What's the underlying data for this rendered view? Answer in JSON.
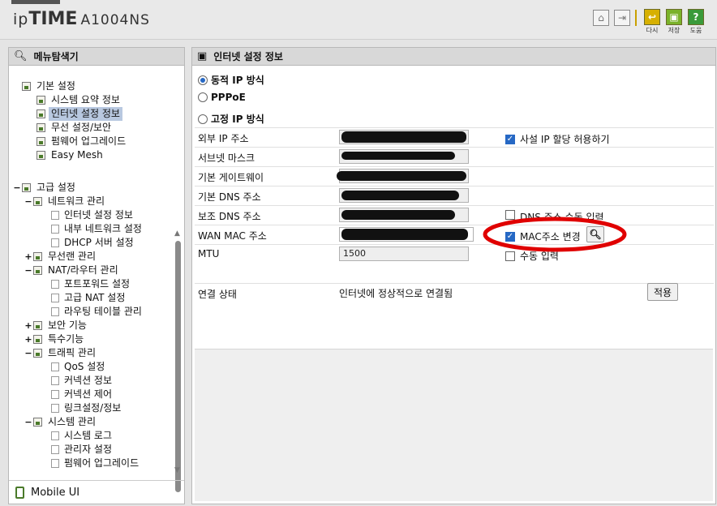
{
  "header": {
    "brand_ip": "ip",
    "brand_time": "TIME",
    "model": "A1004NS",
    "buttons": [
      {
        "label": "다시",
        "icon": "back-icon"
      },
      {
        "label": "저장",
        "icon": "save-icon"
      },
      {
        "label": "도움",
        "icon": "help-icon"
      }
    ]
  },
  "menu": {
    "title": "메뉴탐색기",
    "basic": {
      "label": "기본 설정",
      "items": [
        "시스템 요약 정보",
        "인터넷 설정 정보",
        "무선 설정/보안",
        "펌웨어 업그레이드",
        "Easy Mesh"
      ]
    },
    "advanced": {
      "label": "고급 설정",
      "groups": [
        {
          "toggle": "−",
          "label": "네트워크 관리",
          "items": [
            "인터넷 설정 정보",
            "내부 네트워크 설정",
            "DHCP 서버 설정"
          ]
        },
        {
          "toggle": "+",
          "label": "무선랜 관리",
          "items": []
        },
        {
          "toggle": "−",
          "label": "NAT/라우터 관리",
          "items": [
            "포트포워드 설정",
            "고급 NAT 설정",
            "라우팅 테이블 관리"
          ]
        },
        {
          "toggle": "+",
          "label": "보안 기능",
          "items": []
        },
        {
          "toggle": "+",
          "label": "특수기능",
          "items": []
        },
        {
          "toggle": "−",
          "label": "트래픽 관리",
          "items": [
            "QoS 설정",
            "커넥션 정보",
            "커넥션 제어",
            "링크설정/정보"
          ]
        },
        {
          "toggle": "−",
          "label": "시스템 관리",
          "items": [
            "시스템 로그",
            "관리자 설정",
            "펌웨어 업그레이드"
          ]
        }
      ]
    },
    "mobile": "Mobile UI"
  },
  "content": {
    "title": "인터넷 설정 정보",
    "modes": [
      "동적 IP 방식",
      "PPPoE",
      "고정 IP 방식"
    ],
    "selected_mode": "동적 IP 방식",
    "rows": [
      "외부 IP 주소",
      "서브넷 마스크",
      "기본 게이트웨이",
      "기본 DNS 주소",
      "보조 DNS 주소",
      "WAN MAC 주소",
      "MTU"
    ],
    "mtu_value": "1500",
    "options": {
      "private_ip": "사설 IP 할당 허용하기",
      "dns_manual": "DNS 주소 수동 입력",
      "mac_change": "MAC주소 변경",
      "manual_input": "수동 입력"
    },
    "status_label": "연결 상태",
    "status_value": "인터넷에 정상적으로 연결됨",
    "apply": "적용"
  }
}
